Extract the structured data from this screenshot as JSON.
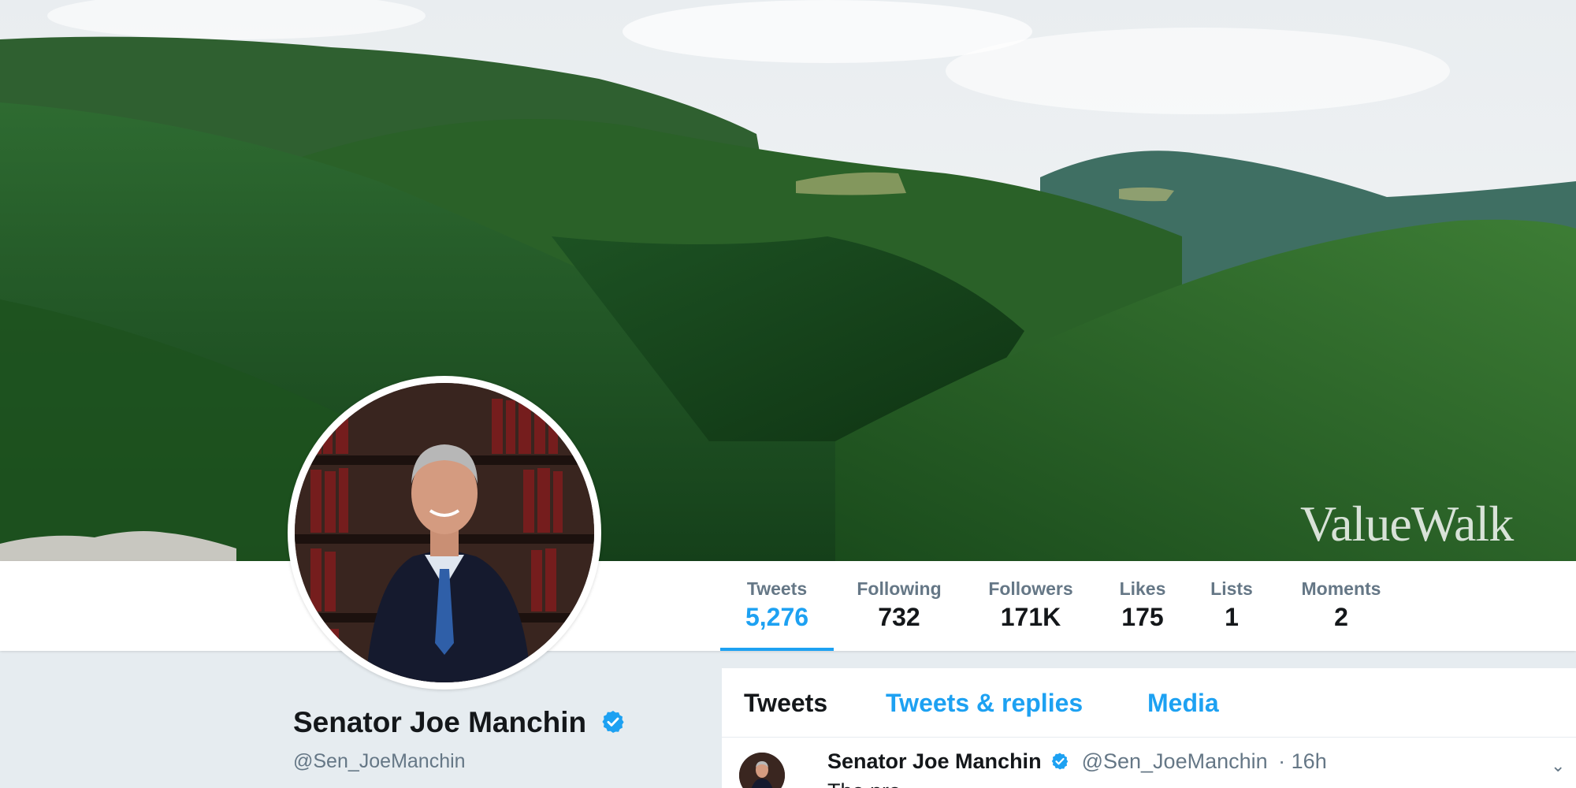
{
  "banner": {
    "watermark": "ValueWalk"
  },
  "stats": [
    {
      "label": "Tweets",
      "value": "5,276",
      "active": true
    },
    {
      "label": "Following",
      "value": "732"
    },
    {
      "label": "Followers",
      "value": "171K"
    },
    {
      "label": "Likes",
      "value": "175"
    },
    {
      "label": "Lists",
      "value": "1"
    },
    {
      "label": "Moments",
      "value": "2"
    }
  ],
  "profile": {
    "name": "Senator Joe Manchin",
    "handle": "@Sen_JoeManchin",
    "verified": true
  },
  "timeline": {
    "tabs": [
      "Tweets",
      "Tweets & replies",
      "Media"
    ],
    "active_tab": "Tweets",
    "tweet": {
      "author": "Senator Joe Manchin",
      "handle": "@Sen_JoeManchin",
      "time": "· 16h",
      "text": "The pro... "
    }
  },
  "colors": {
    "accent": "#1da1f2",
    "text": "#14171a",
    "muted": "#657786",
    "page_bg": "#e6ecf0"
  },
  "icons": {
    "verified": "verified-badge-icon",
    "menu": "chevron-down-icon"
  }
}
